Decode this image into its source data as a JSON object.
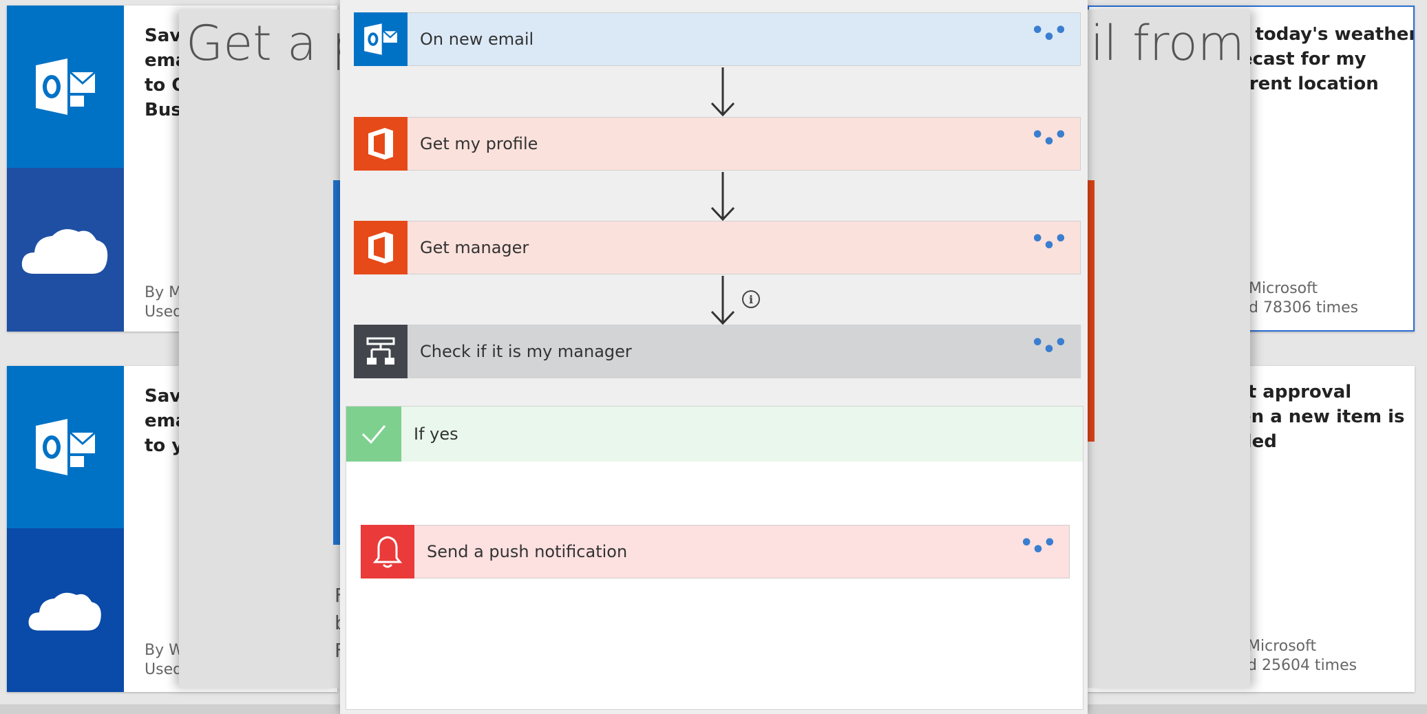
{
  "heading": {
    "left_fragment": "Get a pu",
    "right_fragment": "ail from"
  },
  "cards": {
    "top_left": {
      "title": "Save\nema\nto O\nBusi",
      "by": "By M",
      "used": "Used"
    },
    "bottom_left": {
      "title": "Save\nema\nto y",
      "by": "By W",
      "used": "Used"
    },
    "top_right": {
      "title": "t today's weather\necast for my\nrrent location",
      "by": "Microsoft",
      "used": "d 78306 times"
    },
    "bottom_right": {
      "title": "rt approval\nen a new item is\nded",
      "by": "Microsoft",
      "used": "d 25604 times"
    }
  },
  "mid_fragments": [
    "F",
    "b",
    "F"
  ],
  "flow": {
    "steps": [
      {
        "label": "On new email",
        "icon": "outlook-icon",
        "color": "#dbe9f7",
        "icon_bg": "#0072c6"
      },
      {
        "label": "Get my profile",
        "icon": "office-icon",
        "color": "#fbe1dc",
        "icon_bg": "#e64a19"
      },
      {
        "label": "Get manager",
        "icon": "office-icon",
        "color": "#fbe1dc",
        "icon_bg": "#e64a19"
      },
      {
        "label": "Check if it is my manager",
        "icon": "condition-icon",
        "color": "#d2d4d6",
        "icon_bg": "#42464c"
      }
    ],
    "menu_dots": "• • •",
    "branch": {
      "label": "If yes",
      "action": {
        "label": "Send a push notification",
        "icon": "bell-icon",
        "color": "#fde0e0",
        "icon_bg": "#ea3a3a"
      }
    },
    "info_glyph": "i"
  }
}
